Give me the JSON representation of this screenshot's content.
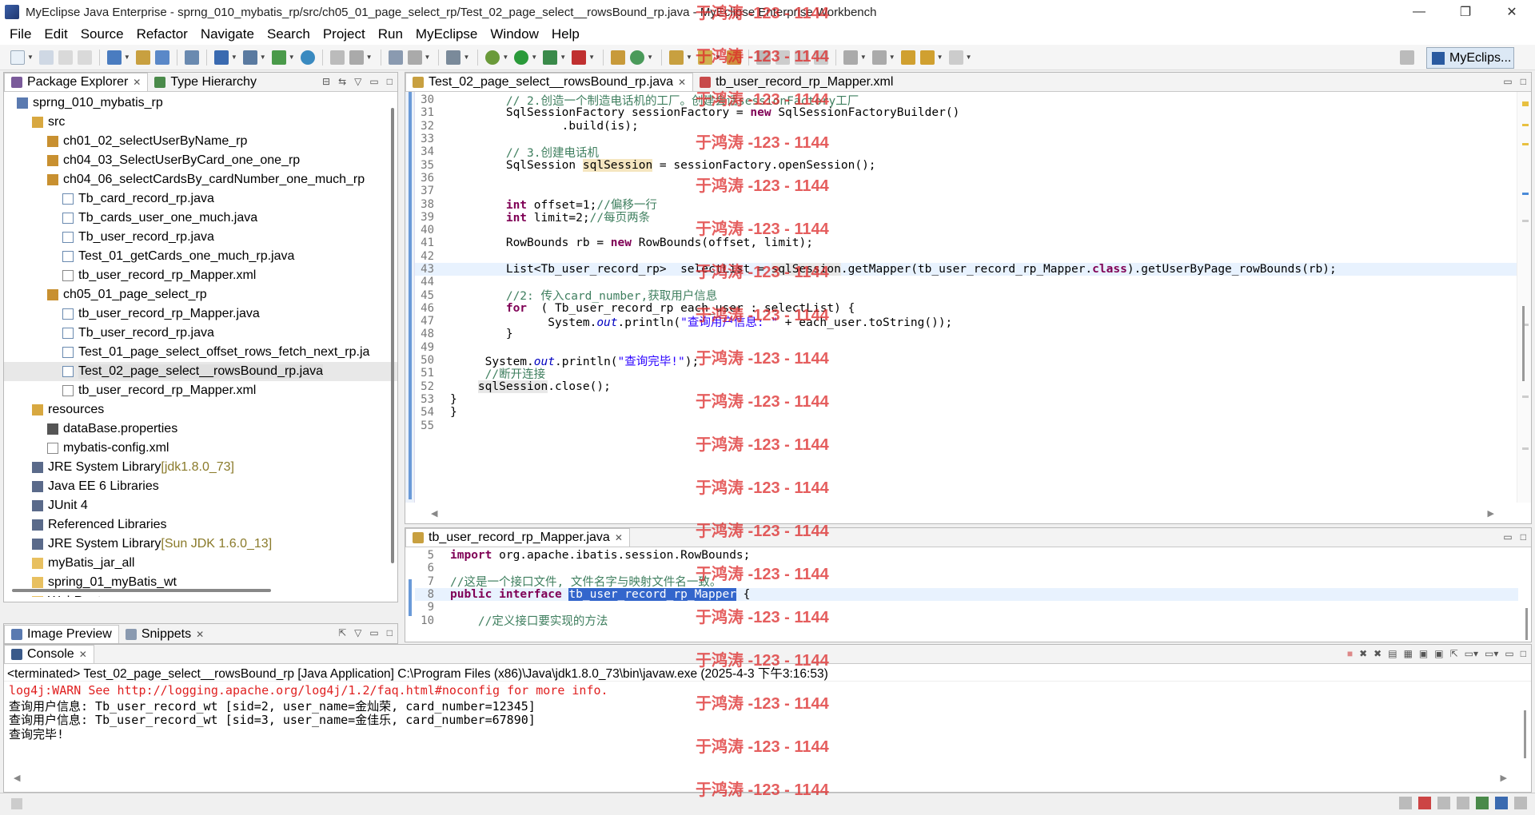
{
  "window": {
    "title": "MyEclipse Java Enterprise - sprng_010_mybatis_rp/src/ch05_01_page_select_rp/Test_02_page_select__rowsBound_rp.java - MyEclipse Enterprise Workbench",
    "minimize": "—",
    "maximize": "❐",
    "close": "✕"
  },
  "menu": [
    "File",
    "Edit",
    "Source",
    "Refactor",
    "Navigate",
    "Search",
    "Project",
    "Run",
    "MyEclipse",
    "Window",
    "Help"
  ],
  "perspective": "MyEclips...",
  "package_explorer": {
    "tabs": [
      "Package Explorer",
      "Type Hierarchy"
    ],
    "tree": [
      {
        "label": "sprng_010_mybatis_rp",
        "indent": 0,
        "icon": "project"
      },
      {
        "label": "src",
        "indent": 1,
        "icon": "srcfolder"
      },
      {
        "label": "ch01_02_selectUserByName_rp",
        "indent": 2,
        "icon": "package"
      },
      {
        "label": "ch04_03_SelectUserByCard_one_one_rp",
        "indent": 2,
        "icon": "package"
      },
      {
        "label": "ch04_06_selectCardsBy_cardNumber_one_much_rp",
        "indent": 2,
        "icon": "package"
      },
      {
        "label": "Tb_card_record_rp.java",
        "indent": 3,
        "icon": "java"
      },
      {
        "label": "Tb_cards_user_one_much.java",
        "indent": 3,
        "icon": "java"
      },
      {
        "label": "Tb_user_record_rp.java",
        "indent": 3,
        "icon": "java"
      },
      {
        "label": "Test_01_getCards_one_much_rp.java",
        "indent": 3,
        "icon": "java"
      },
      {
        "label": "tb_user_record_rp_Mapper.xml",
        "indent": 3,
        "icon": "xml"
      },
      {
        "label": "ch05_01_page_select_rp",
        "indent": 2,
        "icon": "package"
      },
      {
        "label": "tb_user_record_rp_Mapper.java",
        "indent": 3,
        "icon": "java"
      },
      {
        "label": "Tb_user_record_rp.java",
        "indent": 3,
        "icon": "java"
      },
      {
        "label": "Test_01_page_select_offset_rows_fetch_next_rp.ja",
        "indent": 3,
        "icon": "java"
      },
      {
        "label": "Test_02_page_select__rowsBound_rp.java",
        "indent": 3,
        "icon": "java",
        "selected": true
      },
      {
        "label": "tb_user_record_rp_Mapper.xml",
        "indent": 3,
        "icon": "xml"
      },
      {
        "label": "resources",
        "indent": 1,
        "icon": "srcfolder"
      },
      {
        "label": "dataBase.properties",
        "indent": 2,
        "icon": "props"
      },
      {
        "label": "mybatis-config.xml",
        "indent": 2,
        "icon": "xml"
      },
      {
        "label": "JRE System Library",
        "suffix": "[jdk1.8.0_73]",
        "indent": 1,
        "icon": "lib"
      },
      {
        "label": "Java EE 6 Libraries",
        "indent": 1,
        "icon": "lib"
      },
      {
        "label": "JUnit 4",
        "indent": 1,
        "icon": "lib"
      },
      {
        "label": "Referenced Libraries",
        "indent": 1,
        "icon": "lib"
      },
      {
        "label": "JRE System Library",
        "suffix": "[Sun JDK 1.6.0_13]",
        "indent": 1,
        "icon": "lib"
      },
      {
        "label": "myBatis_jar_all",
        "indent": 1,
        "icon": "folder"
      },
      {
        "label": "spring_01_myBatis_wt",
        "indent": 1,
        "icon": "folder"
      },
      {
        "label": "WebRoot",
        "indent": 1,
        "icon": "folder"
      }
    ]
  },
  "bottom_left": {
    "tabs": [
      "Image Preview",
      "Snippets"
    ]
  },
  "editor": {
    "tabs": [
      "Test_02_page_select__rowsBound_rp.java",
      "tb_user_record_rp_Mapper.xml"
    ],
    "lines": [
      {
        "n": "30",
        "text": "        // 2.创造一个制造电话机的工厂。创建会话sessionFactory工厂"
      },
      {
        "n": "31",
        "text": "        SqlSessionFactory sessionFactory = new SqlSessionFactoryBuilder()"
      },
      {
        "n": "32",
        "text": "                .build(is);"
      },
      {
        "n": "33",
        "text": ""
      },
      {
        "n": "34",
        "text": "        // 3.创建电话机"
      },
      {
        "n": "35",
        "text": "        SqlSession sqlSession = sessionFactory.openSession();"
      },
      {
        "n": "36",
        "text": ""
      },
      {
        "n": "37",
        "text": ""
      },
      {
        "n": "38",
        "text": "        int offset=1;//偏移一行"
      },
      {
        "n": "39",
        "text": "        int limit=2;//每页两条"
      },
      {
        "n": "40",
        "text": ""
      },
      {
        "n": "41",
        "text": "        RowBounds rb = new RowBounds(offset, limit);"
      },
      {
        "n": "42",
        "text": ""
      },
      {
        "n": "43",
        "text": "        List<Tb_user_record_rp>  selectList = sqlSession.getMapper(tb_user_record_rp_Mapper.class).getUserByPage_rowBounds(rb);"
      },
      {
        "n": "44",
        "text": ""
      },
      {
        "n": "45",
        "text": "        //2: 传入card_number,获取用户信息"
      },
      {
        "n": "46",
        "text": "        for  ( Tb_user_record_rp each_user : selectList) {"
      },
      {
        "n": "47",
        "text": "              System.out.println(\"查询用户信息: \" + each_user.toString());"
      },
      {
        "n": "48",
        "text": "        }"
      },
      {
        "n": "49",
        "text": ""
      },
      {
        "n": "50",
        "text": "     System.out.println(\"查询完毕!\");"
      },
      {
        "n": "51",
        "text": "     //断开连接"
      },
      {
        "n": "52",
        "text": "    sqlSession.close();"
      },
      {
        "n": "53",
        "text": "}"
      },
      {
        "n": "54",
        "text": "}"
      },
      {
        "n": "55",
        "text": ""
      }
    ]
  },
  "editor2": {
    "tab": "tb_user_record_rp_Mapper.java",
    "lines": [
      {
        "n": "5",
        "text": "import org.apache.ibatis.session.RowBounds;"
      },
      {
        "n": "6",
        "text": ""
      },
      {
        "n": "7",
        "text": "//这是一个接口文件, 文件名字与映射文件名一致。"
      },
      {
        "n": "8",
        "text": "public interface tb_user_record_rp_Mapper {"
      },
      {
        "n": "9",
        "text": ""
      },
      {
        "n": "10",
        "text": "    //定义接口要实现的方法"
      }
    ]
  },
  "console": {
    "tab": "Console",
    "header": "<terminated> Test_02_page_select__rowsBound_rp [Java Application] C:\\Program Files (x86)\\Java\\jdk1.8.0_73\\bin\\javaw.exe (2025-4-3 下午3:16:53)",
    "lines": [
      {
        "text": "log4j:WARN See http://logging.apache.org/log4j/1.2/faq.html#noconfig for more info.",
        "color": "red"
      },
      {
        "text": "查询用户信息: Tb_user_record_wt [sid=2, user_name=金灿荣, card_number=12345]",
        "color": "black"
      },
      {
        "text": "查询用户信息: Tb_user_record_wt [sid=3, user_name=金佳乐, card_number=67890]",
        "color": "black"
      },
      {
        "text": "查询完毕!",
        "color": "black"
      }
    ]
  },
  "watermark": "于鸿涛 -123 - 1144"
}
